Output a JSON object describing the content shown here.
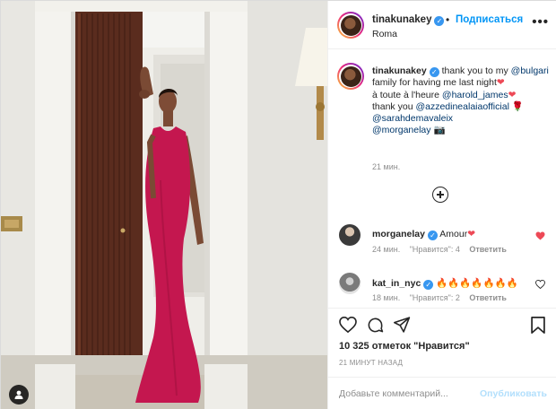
{
  "post": {
    "author": "tinakunakey",
    "follow_label": "Подписаться",
    "separator": "•",
    "location": "Roma",
    "more_glyph": "•••"
  },
  "caption": {
    "username": "tinakunakey",
    "parts": {
      "p1": "thank you to my ",
      "m1": "@bulgari",
      "p2": " family for having me last night",
      "e1": "❤",
      "p3": "à toute à l'heure ",
      "m2": "@harold_james",
      "e2": "❤",
      "p4": "thank you ",
      "m3": "@azzedinealaiaofficial",
      "e3": "🌹",
      "m4": "@sarahdemavaleix",
      "m5": "@morganelay",
      "e4": "📷"
    },
    "time": "21 мин."
  },
  "comments": [
    {
      "username": "morganelay",
      "text": "Amour",
      "emoji": "❤",
      "time": "24 мин.",
      "likes": "\"Нравится\": 4",
      "reply": "Ответить",
      "liked": true
    },
    {
      "username": "kat_in_nyc",
      "text": "🔥🔥🔥🔥🔥🔥🔥",
      "time": "18 мин.",
      "likes": "\"Нравится\": 2",
      "reply": "Ответить",
      "liked": false
    }
  ],
  "footer": {
    "likes": "10 325 отметок \"Нравится\"",
    "posted": "21 МИНУТ НАЗАД",
    "comment_placeholder": "Добавьте комментарий...",
    "publish_label": "Опубликовать"
  },
  "icons": {
    "tag": "person-tag-icon",
    "like": "heart-icon",
    "comment": "comment-icon",
    "share": "share-icon",
    "save": "bookmark-icon",
    "more": "more-icon",
    "view_replies": "plus-circle-icon"
  },
  "colors": {
    "accent": "#0095f6",
    "verified": "#3897f0",
    "liked_heart": "#ed4956",
    "dress": "#c4174f",
    "muted": "#8e8e8e"
  }
}
